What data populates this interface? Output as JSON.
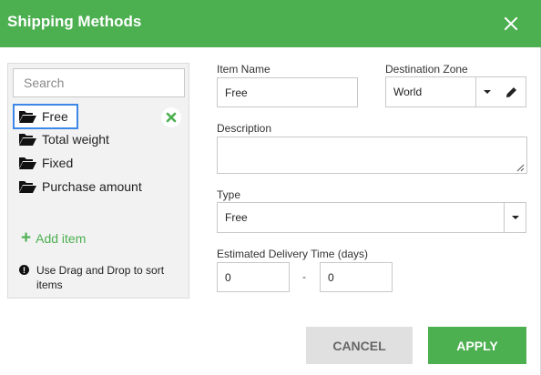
{
  "dialog": {
    "title": "Shipping Methods"
  },
  "colors": {
    "header": "#4caf50",
    "accent_green": "#4caf50",
    "selection_border": "#3d87e8",
    "cancel_bg": "#e0e0e0"
  },
  "icons": {
    "close": "close-icon",
    "folder": "folder-open-icon",
    "remove": "remove-x-icon",
    "add": "plus-icon",
    "info": "info-icon",
    "caret": "caret-down-icon",
    "edit": "pencil-icon"
  },
  "sidebar": {
    "search_placeholder": "Search",
    "items": [
      {
        "label": "Free",
        "selected": true
      },
      {
        "label": "Total weight",
        "selected": false
      },
      {
        "label": "Fixed",
        "selected": false
      },
      {
        "label": "Purchase amount",
        "selected": false
      }
    ],
    "add_item_label": "Add item",
    "hint": "Use Drag and Drop to sort items"
  },
  "form": {
    "item_name_label": "Item Name",
    "item_name_value": "Free",
    "destination_label": "Destination Zone",
    "destination_value": "World",
    "description_label": "Description",
    "description_value": "",
    "type_label": "Type",
    "type_value": "Free",
    "delivery_label": "Estimated Delivery Time (days)",
    "delivery_min": "0",
    "delivery_separator": "-",
    "delivery_max": "0"
  },
  "actions": {
    "cancel_label": "CANCEL",
    "apply_label": "APPLY"
  }
}
